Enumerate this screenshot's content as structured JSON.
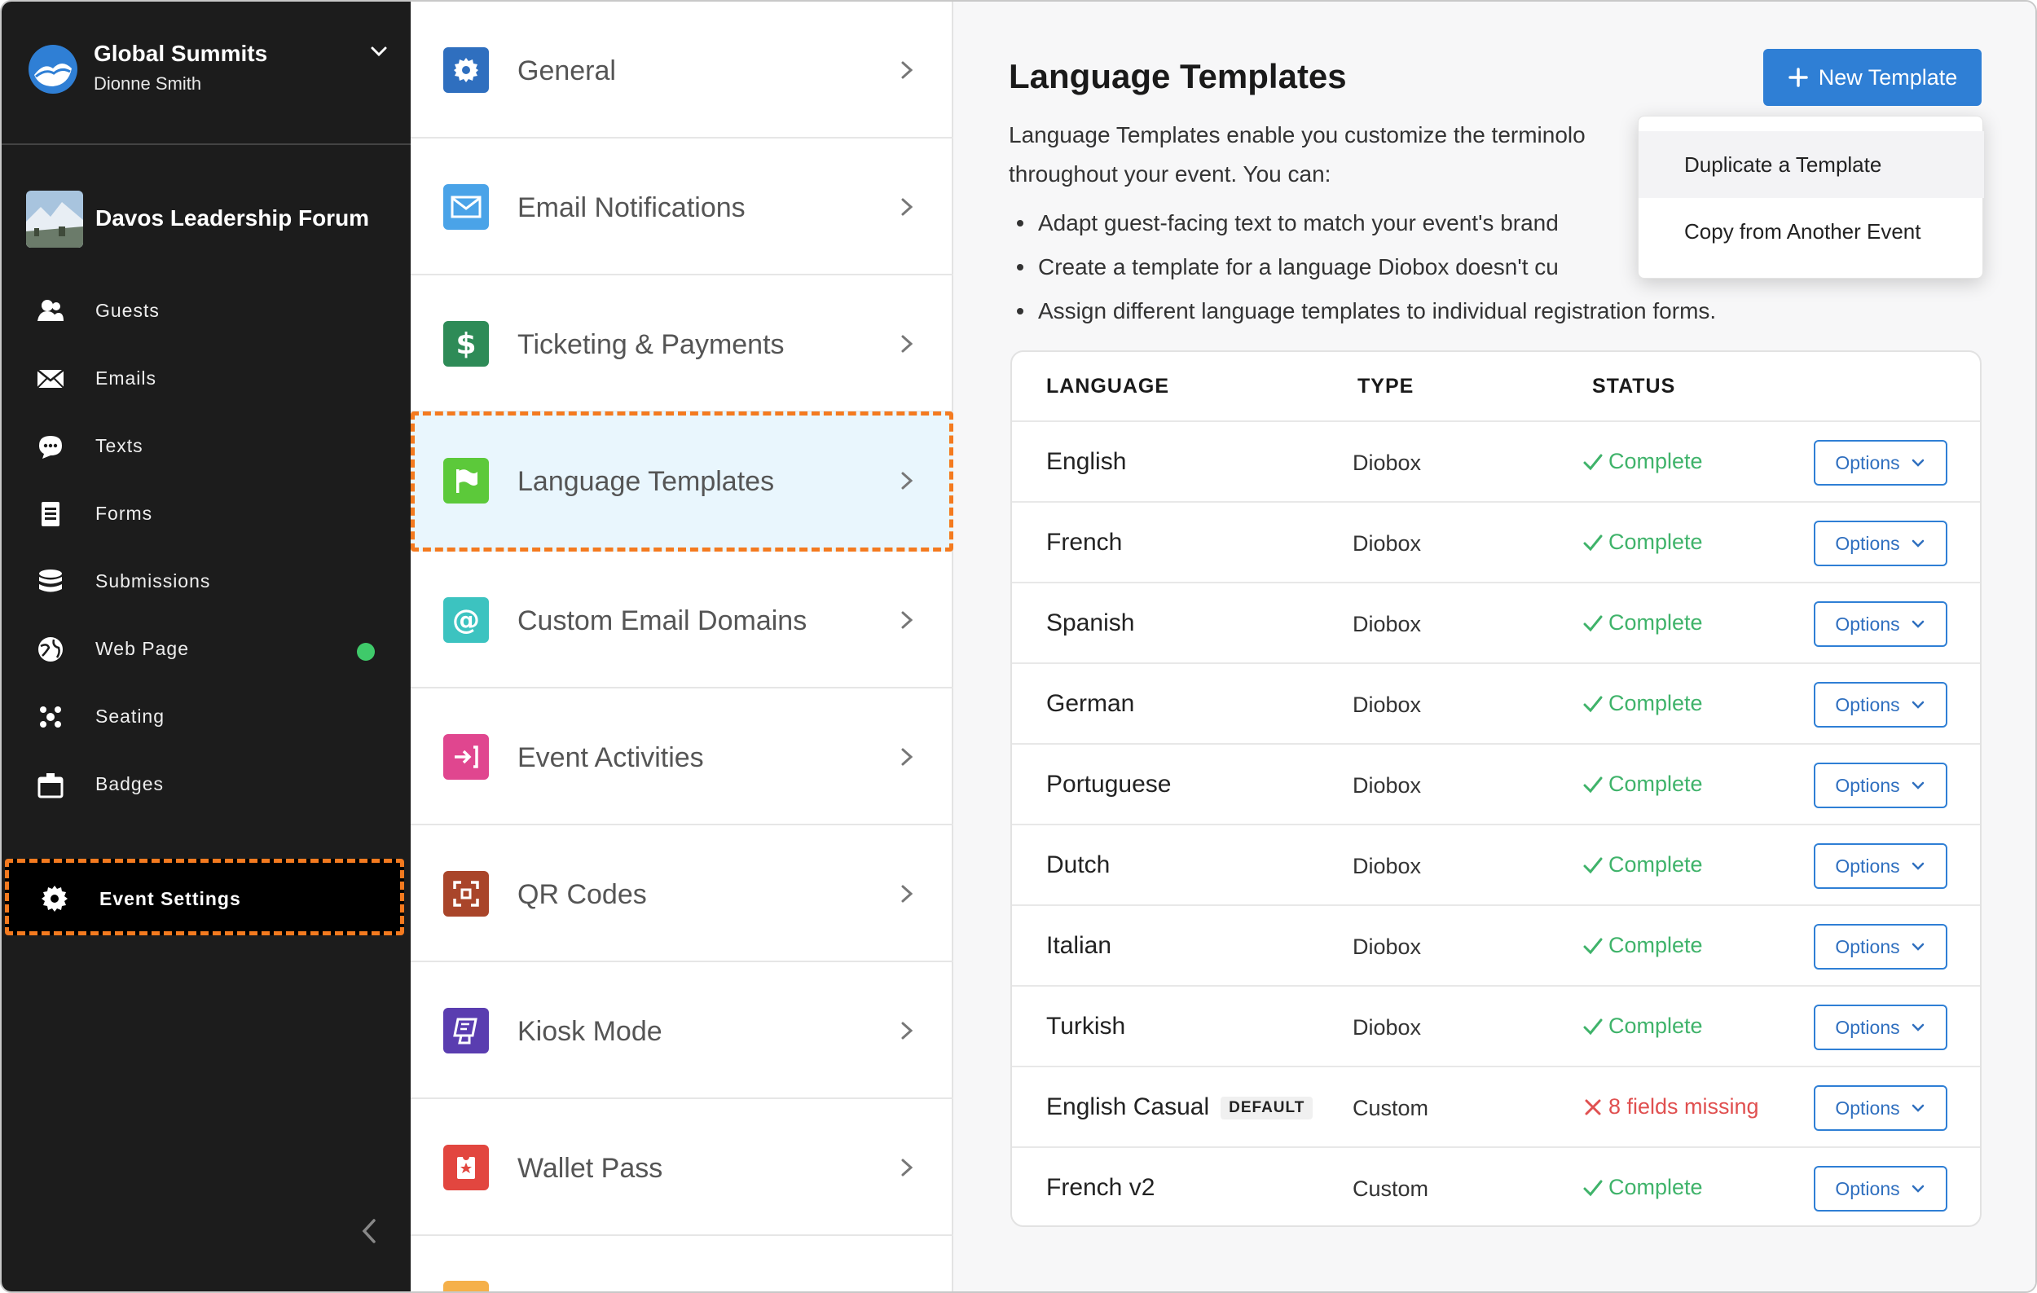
{
  "org": {
    "name": "Global Summits",
    "user": "Dionne Smith"
  },
  "event": {
    "name": "Davos Leadership Forum"
  },
  "nav": [
    {
      "label": "Guests",
      "icon": "guests-icon"
    },
    {
      "label": "Emails",
      "icon": "envelope-icon"
    },
    {
      "label": "Texts",
      "icon": "chat-bubble-icon"
    },
    {
      "label": "Forms",
      "icon": "form-icon"
    },
    {
      "label": "Submissions",
      "icon": "database-icon"
    },
    {
      "label": "Web Page",
      "icon": "globe-icon",
      "status": "online"
    },
    {
      "label": "Seating",
      "icon": "seating-icon"
    },
    {
      "label": "Badges",
      "icon": "badge-icon"
    }
  ],
  "settings_nav": {
    "label": "Event Settings",
    "icon": "gear-icon"
  },
  "settings_menu": [
    {
      "label": "General",
      "icon": "gear-icon",
      "color": "#2f6fbf"
    },
    {
      "label": "Email Notifications",
      "icon": "envelope-icon",
      "color": "#4aa3e8"
    },
    {
      "label": "Ticketing & Payments",
      "icon": "dollar-icon",
      "color": "#2e8b57"
    },
    {
      "label": "Language Templates",
      "icon": "flag-icon",
      "color": "#5cc93a",
      "active": true
    },
    {
      "label": "Custom Email Domains",
      "icon": "at-sign-icon",
      "color": "#3cc3c0"
    },
    {
      "label": "Event Activities",
      "icon": "check-in-icon",
      "color": "#e0468f"
    },
    {
      "label": "QR Codes",
      "icon": "qr-scan-icon",
      "color": "#a9452a"
    },
    {
      "label": "Kiosk Mode",
      "icon": "kiosk-icon",
      "color": "#5a3db0"
    },
    {
      "label": "Wallet Pass",
      "icon": "ticket-star-icon",
      "color": "#e2463f"
    }
  ],
  "main": {
    "title": "Language Templates",
    "new_button": "New Template",
    "intro_line1": "Language Templates enable you customize the terminolo",
    "intro_line2": "throughout your event. You can:",
    "bullets": [
      "Adapt guest-facing text to match your event's brand",
      "Create a template for a language Diobox doesn't cu",
      "Assign different language templates to individual registration forms."
    ]
  },
  "dropdown": {
    "items": [
      "Duplicate a Template",
      "Copy from Another Event"
    ]
  },
  "table": {
    "headers": [
      "LANGUAGE",
      "TYPE",
      "STATUS"
    ],
    "option_label": "Options",
    "rows": [
      {
        "language": "English",
        "type": "Diobox",
        "status": "Complete",
        "ok": true
      },
      {
        "language": "French",
        "type": "Diobox",
        "status": "Complete",
        "ok": true
      },
      {
        "language": "Spanish",
        "type": "Diobox",
        "status": "Complete",
        "ok": true
      },
      {
        "language": "German",
        "type": "Diobox",
        "status": "Complete",
        "ok": true
      },
      {
        "language": "Portuguese",
        "type": "Diobox",
        "status": "Complete",
        "ok": true
      },
      {
        "language": "Dutch",
        "type": "Diobox",
        "status": "Complete",
        "ok": true
      },
      {
        "language": "Italian",
        "type": "Diobox",
        "status": "Complete",
        "ok": true
      },
      {
        "language": "Turkish",
        "type": "Diobox",
        "status": "Complete",
        "ok": true
      },
      {
        "language": "English Casual",
        "badge": "DEFAULT",
        "type": "Custom",
        "status": "8 fields missing",
        "ok": false
      },
      {
        "language": "French v2",
        "type": "Custom",
        "status": "Complete",
        "ok": true
      }
    ]
  },
  "colors": {
    "accent": "#2f7fd5",
    "success": "#3fb36a",
    "error": "#e05050",
    "highlight": "#f47a1f"
  }
}
